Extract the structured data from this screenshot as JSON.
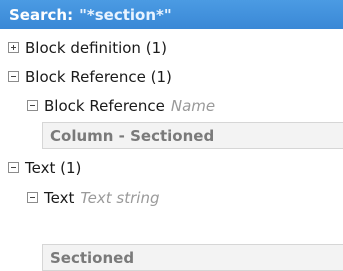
{
  "search": {
    "label": "Search:",
    "term": "\"*section*\""
  },
  "tree": {
    "block_definition": {
      "label": "Block definition (1)"
    },
    "block_reference": {
      "label": "Block Reference (1)",
      "child": {
        "label": "Block Reference",
        "type": "Name",
        "value": "Column - Sectioned"
      }
    },
    "text": {
      "label": "Text (1)",
      "child": {
        "label": "Text",
        "type": "Text string",
        "value": "Sectioned"
      }
    }
  }
}
